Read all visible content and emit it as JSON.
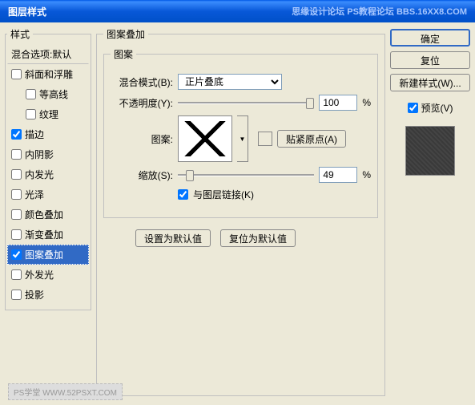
{
  "title": "图层样式",
  "watermark_top": "思缘设计论坛  PS教程论坛 BBS.16XX8.COM",
  "styles_panel": {
    "legend": "样式",
    "blend_options": "混合选项:默认",
    "items": [
      {
        "label": "斜面和浮雕",
        "checked": false
      },
      {
        "label": "等高线",
        "checked": false,
        "indent": true
      },
      {
        "label": "纹理",
        "checked": false,
        "indent": true
      },
      {
        "label": "描边",
        "checked": true
      },
      {
        "label": "内阴影",
        "checked": false
      },
      {
        "label": "内发光",
        "checked": false
      },
      {
        "label": "光泽",
        "checked": false
      },
      {
        "label": "颜色叠加",
        "checked": false
      },
      {
        "label": "渐变叠加",
        "checked": false
      },
      {
        "label": "图案叠加",
        "checked": true,
        "selected": true
      },
      {
        "label": "外发光",
        "checked": false
      },
      {
        "label": "投影",
        "checked": false
      }
    ]
  },
  "main": {
    "legend": "图案叠加",
    "inner_legend": "图案",
    "blend_mode_label": "混合模式(B):",
    "blend_mode_value": "正片叠底",
    "opacity_label": "不透明度(Y):",
    "opacity_value": "100",
    "percent": "%",
    "pattern_label": "图案:",
    "snap_origin": "贴紧原点(A)",
    "scale_label": "缩放(S):",
    "scale_value": "49",
    "link_layer": "与图层链接(K)",
    "set_default": "设置为默认值",
    "reset_default": "复位为默认值"
  },
  "right": {
    "ok": "确定",
    "reset": "复位",
    "new_style": "新建样式(W)...",
    "preview": "预览(V)"
  },
  "footer_wm": "PS学堂  WWW.52PSXT.COM"
}
